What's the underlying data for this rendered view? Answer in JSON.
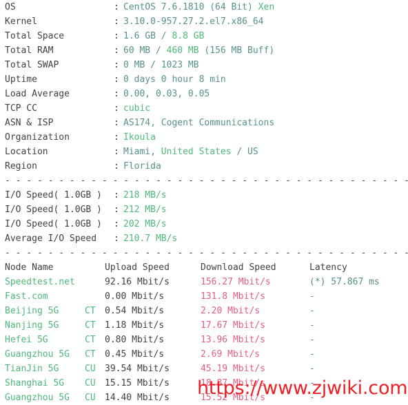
{
  "terminal": {
    "colors": {
      "background": "#ffffff",
      "label": "#3d4144",
      "value_teal": "#56908c",
      "value_green": "#4eb87a",
      "download_pink": "#e35d82",
      "separator": "#4a4f52",
      "watermark": "#ec2024"
    },
    "separator_line": "- - - - - - - - - - - - - - - - - - - - - - - - - - - - - - - - - - - - - - - - - - - - - - -"
  },
  "system_info": [
    {
      "label": "OS",
      "colon": ":",
      "parts": [
        {
          "text": "CentOS 7.6.1810 (64 Bit) ",
          "color": "teal"
        },
        {
          "text": "Xen",
          "color": "green"
        }
      ]
    },
    {
      "label": "Kernel",
      "colon": ":",
      "parts": [
        {
          "text": "3.10.0-957.27.2.el7.x86_64",
          "color": "teal"
        }
      ]
    },
    {
      "label": "Total Space",
      "colon": ":",
      "parts": [
        {
          "text": "1.6 GB / ",
          "color": "teal"
        },
        {
          "text": "8.8 GB",
          "color": "green"
        }
      ]
    },
    {
      "label": "Total RAM",
      "colon": ":",
      "parts": [
        {
          "text": "60 MB / ",
          "color": "teal"
        },
        {
          "text": "460 MB",
          "color": "green"
        },
        {
          "text": " (156 MB Buff)",
          "color": "teal"
        }
      ]
    },
    {
      "label": "Total SWAP",
      "colon": ":",
      "parts": [
        {
          "text": "0 MB / 1023 MB",
          "color": "teal"
        }
      ]
    },
    {
      "label": "Uptime",
      "colon": ":",
      "parts": [
        {
          "text": "0 days 0 hour 8 min",
          "color": "teal"
        }
      ]
    },
    {
      "label": "Load Average",
      "colon": ":",
      "parts": [
        {
          "text": "0.00, 0.03, 0.05",
          "color": "teal"
        }
      ]
    },
    {
      "label": "TCP CC",
      "colon": ":",
      "parts": [
        {
          "text": "cubic",
          "color": "green"
        }
      ]
    },
    {
      "label": "ASN & ISP",
      "colon": ":",
      "parts": [
        {
          "text": "AS174, Cogent Communications",
          "color": "teal"
        }
      ]
    },
    {
      "label": "Organization",
      "colon": ":",
      "parts": [
        {
          "text": "Ikoula",
          "color": "green"
        }
      ]
    },
    {
      "label": "Location",
      "colon": ":",
      "parts": [
        {
          "text": "Miami, ",
          "color": "teal"
        },
        {
          "text": "United States",
          "color": "green"
        },
        {
          "text": " / US",
          "color": "teal"
        }
      ]
    },
    {
      "label": "Region",
      "colon": ":",
      "parts": [
        {
          "text": "Florida",
          "color": "teal"
        }
      ]
    }
  ],
  "io_tests": [
    {
      "label": "I/O Speed( 1.0GB )",
      "colon": ":",
      "value": "218 MB/s"
    },
    {
      "label": "I/O Speed( 1.0GB )",
      "colon": ":",
      "value": "212 MB/s"
    },
    {
      "label": "I/O Speed( 1.0GB )",
      "colon": ":",
      "value": "202 MB/s"
    },
    {
      "label": "Average I/O Speed",
      "colon": ":",
      "value": "210.7 MB/s"
    }
  ],
  "speedtest": {
    "headers": {
      "node": "Node Name",
      "carrier": "",
      "upload": "Upload Speed",
      "download": "Download Speed",
      "latency": "Latency"
    },
    "rows": [
      {
        "node": "Speedtest.net",
        "carrier": "",
        "upload": "92.16 Mbit/s",
        "download": "156.27 Mbit/s",
        "latency": "(*) 57.867 ms"
      },
      {
        "node": "Fast.com",
        "carrier": "",
        "upload": "0.00 Mbit/s",
        "download": "131.8 Mbit/s",
        "latency": "-"
      },
      {
        "node": "Beijing 5G",
        "carrier": "CT",
        "upload": "0.54 Mbit/s",
        "download": "2.20 Mbit/s",
        "latency": "-"
      },
      {
        "node": "Nanjing 5G",
        "carrier": "CT",
        "upload": "1.18 Mbit/s",
        "download": "17.67 Mbit/s",
        "latency": "-"
      },
      {
        "node": "Hefei 5G",
        "carrier": "CT",
        "upload": "0.80 Mbit/s",
        "download": "13.96 Mbit/s",
        "latency": "-"
      },
      {
        "node": "Guangzhou 5G",
        "carrier": "CT",
        "upload": "0.45 Mbit/s",
        "download": "2.69 Mbit/s",
        "latency": "-"
      },
      {
        "node": "TianJin 5G",
        "carrier": "CU",
        "upload": "39.54 Mbit/s",
        "download": "45.19 Mbit/s",
        "latency": "-"
      },
      {
        "node": "Shanghai 5G",
        "carrier": "CU",
        "upload": "15.15 Mbit/s",
        "download": "18.87 Mbit/s",
        "latency": "-"
      },
      {
        "node": "Guangzhou 5G",
        "carrier": "CU",
        "upload": "14.40 Mbit/s",
        "download": "15.52 Mbit/s",
        "latency": "-"
      }
    ]
  },
  "watermark": {
    "text": "https://www.zjwiki.com"
  }
}
